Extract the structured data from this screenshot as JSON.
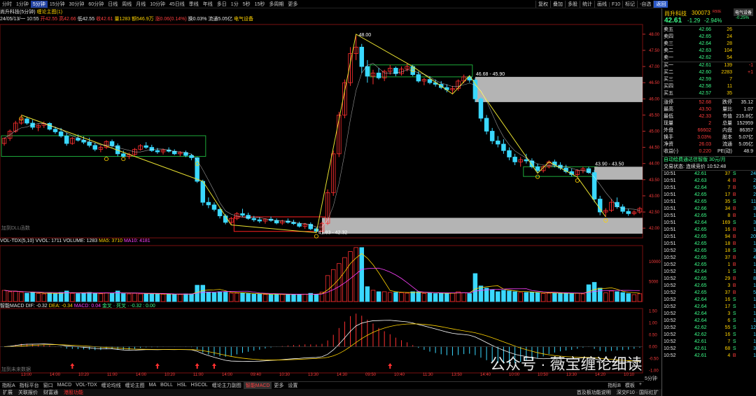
{
  "toolbar": {
    "periods": [
      "分时",
      "1分钟",
      "5分钟",
      "15分钟",
      "30分钟",
      "60分钟",
      "日线",
      "周线",
      "月线",
      "10分钟",
      "45日线",
      "季线",
      "年线",
      "多日",
      "1分",
      "5秒",
      "15秒",
      "多周期",
      "更多"
    ],
    "active_period": "5分钟",
    "right": [
      "复权",
      "叠加",
      "多股",
      "统计",
      "画线",
      "F10",
      "标记",
      "-自选",
      "返回"
    ],
    "active_right": "返回"
  },
  "info": {
    "line1_name": "尚升科技(5分钟)",
    "line1_b": "缠论主图(1)",
    "line2": {
      "date": "24/05/13/一 10:55",
      "open": "开42.55",
      "high": "高42.66",
      "low": "低42.55",
      "close": "收42.61",
      "vol": "量1283",
      "amount": "额546.9万",
      "change": "涨0.06(0.14%)",
      "turnover": "换0.03%",
      "float": "流通5.05亿",
      "sector": "电气设备"
    }
  },
  "chart_data": [
    {
      "type": "candlestick",
      "title": "缠论主图",
      "ylim": [
        41.7,
        48.3
      ],
      "y_ticks": [
        "48.00",
        "47.50",
        "47.00",
        "46.50",
        "46.00",
        "45.50",
        "45.00",
        "44.50",
        "44.00",
        "43.50",
        "43.00",
        "42.50",
        "42.00"
      ],
      "x_ticks": [
        "13:00",
        "14:00",
        "10:20",
        "11:00",
        "14:00",
        "10:20",
        "11:00",
        "14:00",
        "09:40",
        "10:30",
        "13:30",
        "14:30",
        "09:50",
        "10:40",
        "11:30",
        "13:50",
        "14:40",
        "10:00",
        "10:50",
        "13:30",
        "14:20",
        "10:10"
      ],
      "candles": [
        [
          44.62,
          44.8,
          44.55,
          44.78
        ],
        [
          44.78,
          45.05,
          44.7,
          45.0
        ],
        [
          45.0,
          45.32,
          44.95,
          45.25
        ],
        [
          45.25,
          45.5,
          45.2,
          45.38
        ],
        [
          45.38,
          45.45,
          45.2,
          45.25
        ],
        [
          45.25,
          45.35,
          45.05,
          45.12
        ],
        [
          45.12,
          45.22,
          45.0,
          45.18
        ],
        [
          45.18,
          45.3,
          45.1,
          45.24
        ],
        [
          45.24,
          45.28,
          45.02,
          45.06
        ],
        [
          45.06,
          45.14,
          44.92,
          44.98
        ],
        [
          44.98,
          45.1,
          44.8,
          44.85
        ],
        [
          44.85,
          44.95,
          44.55,
          44.62
        ],
        [
          44.62,
          44.82,
          44.58,
          44.78
        ],
        [
          44.78,
          44.9,
          44.68,
          44.72
        ],
        [
          44.72,
          44.84,
          44.6,
          44.66
        ],
        [
          44.66,
          44.8,
          44.5,
          44.56
        ],
        [
          44.56,
          44.64,
          44.38,
          44.44
        ],
        [
          44.44,
          44.56,
          44.35,
          44.5
        ],
        [
          44.5,
          44.72,
          44.45,
          44.68
        ],
        [
          44.68,
          44.74,
          44.5,
          44.55
        ],
        [
          44.55,
          44.62,
          44.22,
          44.3
        ],
        [
          44.3,
          44.4,
          44.18,
          44.22
        ],
        [
          44.22,
          44.34,
          44.14,
          44.28
        ],
        [
          44.28,
          44.48,
          44.24,
          44.44
        ],
        [
          44.44,
          44.6,
          44.4,
          44.55
        ],
        [
          44.55,
          44.66,
          44.45,
          44.5
        ],
        [
          44.5,
          44.58,
          44.36,
          44.4
        ],
        [
          44.4,
          44.48,
          44.3,
          44.36
        ],
        [
          44.36,
          44.46,
          44.28,
          44.42
        ],
        [
          44.42,
          44.5,
          44.34,
          44.38
        ],
        [
          44.38,
          44.44,
          44.26,
          44.3
        ],
        [
          44.3,
          44.38,
          44.22,
          44.34
        ],
        [
          44.34,
          44.4,
          44.2,
          44.25
        ],
        [
          44.25,
          44.3,
          44.1,
          44.18
        ],
        [
          44.18,
          44.2,
          43.4,
          43.45
        ],
        [
          43.45,
          43.5,
          42.7,
          42.8
        ],
        [
          42.8,
          42.95,
          42.62,
          42.72
        ],
        [
          42.72,
          42.8,
          42.52,
          42.58
        ],
        [
          42.58,
          42.65,
          42.3,
          42.38
        ],
        [
          42.38,
          42.44,
          42.12,
          42.18
        ],
        [
          42.18,
          42.35,
          42.1,
          42.3
        ],
        [
          42.3,
          42.5,
          42.25,
          42.45
        ],
        [
          42.45,
          42.6,
          42.35,
          42.4
        ],
        [
          42.4,
          42.48,
          42.26,
          42.3
        ],
        [
          42.3,
          42.38,
          42.2,
          42.26
        ],
        [
          42.26,
          42.34,
          42.16,
          42.22
        ],
        [
          42.22,
          42.3,
          42.14,
          42.28
        ],
        [
          42.28,
          42.36,
          42.2,
          42.24
        ],
        [
          42.24,
          42.3,
          42.12,
          42.16
        ],
        [
          42.16,
          42.26,
          42.1,
          42.22
        ],
        [
          42.22,
          42.3,
          42.14,
          42.18
        ],
        [
          42.18,
          42.26,
          42.1,
          42.14
        ],
        [
          42.14,
          42.2,
          42.02,
          42.06
        ],
        [
          42.06,
          42.16,
          41.98,
          42.12
        ],
        [
          42.12,
          42.18,
          41.94,
          41.98
        ],
        [
          41.98,
          42.02,
          41.86,
          41.9
        ],
        [
          41.9,
          42.2,
          41.88,
          42.15
        ],
        [
          42.15,
          43.2,
          42.1,
          43.1
        ],
        [
          43.1,
          44.4,
          43.0,
          44.3
        ],
        [
          44.3,
          45.6,
          44.2,
          45.5
        ],
        [
          45.5,
          46.6,
          45.4,
          46.5
        ],
        [
          46.5,
          47.6,
          46.4,
          47.4
        ],
        [
          47.4,
          48.0,
          47.2,
          47.6
        ],
        [
          47.6,
          47.7,
          46.8,
          47.0
        ],
        [
          47.0,
          47.2,
          46.5,
          46.7
        ],
        [
          46.7,
          46.9,
          46.45,
          46.8
        ],
        [
          46.8,
          46.95,
          46.6,
          46.65
        ],
        [
          46.65,
          46.9,
          46.55,
          46.85
        ],
        [
          46.85,
          47.05,
          46.75,
          46.95
        ],
        [
          46.95,
          47.0,
          46.7,
          46.78
        ],
        [
          46.78,
          47.0,
          46.72,
          46.92
        ],
        [
          46.92,
          47.1,
          46.85,
          47.0
        ],
        [
          47.0,
          47.05,
          46.7,
          46.75
        ],
        [
          46.75,
          46.85,
          46.5,
          46.55
        ],
        [
          46.55,
          46.65,
          46.42,
          46.6
        ],
        [
          46.6,
          46.7,
          46.45,
          46.5
        ],
        [
          46.5,
          46.6,
          46.38,
          46.45
        ],
        [
          46.45,
          46.55,
          46.3,
          46.35
        ],
        [
          46.35,
          46.45,
          46.2,
          46.28
        ],
        [
          46.28,
          46.4,
          46.15,
          46.32
        ],
        [
          46.32,
          46.6,
          46.25,
          46.55
        ],
        [
          46.55,
          46.75,
          46.48,
          46.68
        ],
        [
          46.68,
          46.72,
          46.5,
          46.58
        ],
        [
          46.58,
          46.64,
          45.9,
          46.0
        ],
        [
          46.0,
          46.05,
          45.3,
          45.4
        ],
        [
          45.4,
          45.5,
          44.9,
          45.0
        ],
        [
          45.0,
          45.1,
          44.6,
          44.7
        ],
        [
          44.7,
          44.85,
          44.5,
          44.6
        ],
        [
          44.6,
          44.75,
          44.3,
          44.4
        ],
        [
          44.4,
          44.5,
          44.1,
          44.2
        ],
        [
          44.2,
          44.3,
          43.95,
          44.05
        ],
        [
          44.05,
          44.2,
          43.9,
          44.12
        ],
        [
          44.12,
          44.3,
          44.0,
          44.08
        ],
        [
          44.08,
          44.16,
          43.85,
          43.9
        ],
        [
          43.9,
          44.0,
          43.7,
          43.78
        ],
        [
          43.78,
          43.95,
          43.72,
          43.9
        ],
        [
          43.9,
          44.1,
          43.85,
          44.05
        ],
        [
          44.05,
          44.12,
          43.88,
          43.95
        ],
        [
          43.95,
          44.04,
          43.8,
          43.86
        ],
        [
          43.86,
          43.96,
          43.7,
          43.75
        ],
        [
          43.75,
          43.84,
          43.6,
          43.66
        ],
        [
          43.66,
          43.82,
          43.58,
          43.78
        ],
        [
          43.78,
          43.9,
          43.7,
          43.84
        ],
        [
          43.84,
          43.9,
          43.68,
          43.72
        ],
        [
          43.72,
          43.8,
          42.8,
          42.9
        ],
        [
          42.9,
          43.0,
          42.4,
          42.5
        ],
        [
          42.5,
          42.62,
          42.35,
          42.55
        ],
        [
          42.55,
          42.9,
          42.5,
          42.8
        ],
        [
          42.8,
          42.95,
          42.6,
          42.66
        ],
        [
          42.66,
          42.74,
          42.45,
          42.52
        ],
        [
          42.52,
          42.6,
          42.38,
          42.45
        ],
        [
          42.45,
          42.55,
          42.4,
          42.5
        ],
        [
          42.5,
          42.66,
          42.45,
          42.61
        ]
      ]
    },
    {
      "type": "bar",
      "title": "VOL-TDX(5,10)",
      "ylim": [
        0,
        14000
      ],
      "y_ticks": [
        "10000",
        "5000"
      ],
      "series_names": [
        "VOLUME",
        "MA5",
        "MA10"
      ]
    },
    {
      "type": "line",
      "title": "智能MACD",
      "ylim": [
        -1.1,
        1.6
      ],
      "y_ticks": [
        "1.50",
        "1.00",
        "0.50",
        "0.00",
        "-0.50",
        "-1.00"
      ],
      "series_names": [
        "DIF",
        "DEA",
        "MACD"
      ]
    }
  ],
  "vol": {
    "label": "VOL-TDX(5,10)",
    "vvol": "VVOL: 1711",
    "volume": "VOLUME: 1283",
    "ma5": "MA5: 3710",
    "ma10": "MA10: 4181"
  },
  "macd": {
    "label": "智能MACD",
    "dif": "DIF: -0.32",
    "dea": "DEA: -0.34",
    "macd": "MACD: 0.04",
    "extra": "金叉 · 死叉 · -0.32 : 0.00"
  },
  "labels": {
    "kline_hint": "加到DLL函数",
    "macd_hint": "加到未来数据",
    "box1": "46.68 - 45.90",
    "box2": "43.90 - 43.50",
    "box3": "48.00",
    "box4": "41.83 - 42.32",
    "right_hint": "5分钟"
  },
  "bottom_tabs": [
    "指标A",
    "指标平台",
    "窗口",
    "MACD",
    "VOL-TDX",
    "缠论均线",
    "缠论主图",
    "MA",
    "BOLL",
    "HSL",
    "HSCOL",
    "缠论主力副图",
    "智能MACD",
    "更多",
    "设置"
  ],
  "active_bottom": "智能MACD",
  "bottom_right": [
    "指标B",
    "模板",
    "+"
  ],
  "status": {
    "left": [
      "扩展",
      "关联报价",
      "财富通",
      "港股功能"
    ],
    "right": "首及板功能说明",
    "right2": "深交F10 · 国际红扩"
  },
  "watermark": "公众号 · 薇宝缠论细读",
  "quote": {
    "name": "尚升科技",
    "code": "300073",
    "tag": "R50E",
    "sector": "电气设备",
    "sector_chg": "-0.25%",
    "price": "42.61",
    "chg": "-1.29",
    "pct": "-2.94%",
    "asks": [
      [
        "卖五",
        "42.66",
        "26",
        ""
      ],
      [
        "卖四",
        "42.65",
        "24",
        ""
      ],
      [
        "卖三",
        "42.64",
        "28",
        ""
      ],
      [
        "卖二",
        "42.63",
        "104",
        ""
      ],
      [
        "卖一",
        "42.62",
        "54",
        ""
      ]
    ],
    "bids": [
      [
        "买一",
        "42.61",
        "139",
        "-1"
      ],
      [
        "买二",
        "42.60",
        "2283",
        "+1"
      ],
      [
        "买三",
        "42.59",
        "7",
        ""
      ],
      [
        "买四",
        "42.58",
        "11",
        ""
      ],
      [
        "买五",
        "42.57",
        "35",
        ""
      ]
    ],
    "stats": [
      [
        "涨停",
        "52.68",
        "跌停",
        "35.12"
      ],
      [
        "最高",
        "43.50",
        "量比",
        "1.07"
      ],
      [
        "最低",
        "42.33",
        "市值",
        "215.8亿"
      ],
      [
        "现量",
        "2",
        "总量",
        "152959"
      ],
      [
        "外盘",
        "66602",
        "内盘",
        "86357"
      ],
      [
        "换手",
        "3.03%",
        "股本",
        "5.07亿"
      ],
      [
        "净资",
        "26.03",
        "流通",
        "5.05亿"
      ],
      [
        "收益(-)",
        "0.220",
        "PE(动)",
        "48.9"
      ]
    ],
    "promo": "自动绘费通达信智版  30元/月",
    "trade_state": "交易状态: 连续竞价 10:52:48",
    "ticks": [
      [
        "10:51",
        "42.61",
        "37",
        "S",
        "24"
      ],
      [
        "10:51",
        "42.63",
        "4",
        "B",
        "2"
      ],
      [
        "10:51",
        "42.64",
        "7",
        "B",
        "5"
      ],
      [
        "10:51",
        "42.65",
        "17",
        "B",
        "2"
      ],
      [
        "10:51",
        "42.65",
        "35",
        "S",
        "11"
      ],
      [
        "10:51",
        "42.66",
        "34",
        "B",
        "3"
      ],
      [
        "10:51",
        "42.65",
        "8",
        "B",
        "1"
      ],
      [
        "10:51",
        "42.64",
        "169",
        "S",
        "3"
      ],
      [
        "10:51",
        "42.65",
        "16",
        "B",
        "1"
      ],
      [
        "10:51",
        "42.65",
        "94",
        "B",
        "20"
      ],
      [
        "10:51",
        "42.65",
        "18",
        "B",
        "1"
      ],
      [
        "10:52",
        "42.65",
        "18",
        "S",
        "3"
      ],
      [
        "10:52",
        "42.65",
        "37",
        "B",
        "4"
      ],
      [
        "10:52",
        "42.65",
        "1",
        "B",
        "1"
      ],
      [
        "10:52",
        "42.64",
        "1",
        "S",
        "1"
      ],
      [
        "10:52",
        "42.65",
        "29",
        "B",
        "8"
      ],
      [
        "10:52",
        "42.65",
        "3",
        "B",
        "1"
      ],
      [
        "10:52",
        "42.65",
        "37",
        "B",
        "5"
      ],
      [
        "10:52",
        "42.64",
        "16",
        "S",
        "1"
      ],
      [
        "10:52",
        "42.64",
        "17",
        "S",
        "1"
      ],
      [
        "10:52",
        "42.64",
        "3",
        "S",
        "1"
      ],
      [
        "10:52",
        "42.64",
        "6",
        "S",
        "1"
      ],
      [
        "10:52",
        "42.62",
        "55",
        "S",
        "12"
      ],
      [
        "10:52",
        "42.62",
        "16",
        "S",
        "1"
      ],
      [
        "10:52",
        "42.61",
        "7",
        "S",
        "1"
      ],
      [
        "10:52",
        "42.61",
        "68",
        "S",
        "3"
      ],
      [
        "10:52",
        "42.61",
        "4",
        "B",
        "1"
      ]
    ]
  }
}
